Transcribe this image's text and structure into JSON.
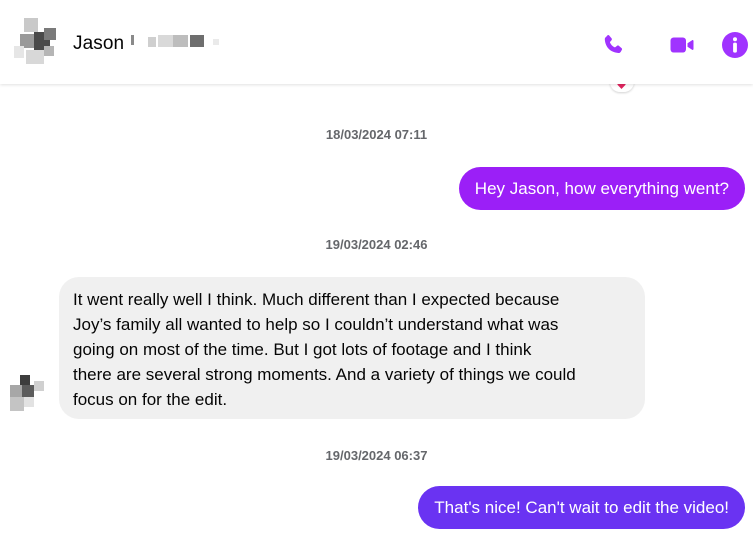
{
  "header": {
    "contact_name": "Jason",
    "avatar_icon": "contact-avatar-pixelated",
    "actions": [
      {
        "name": "voice-call",
        "icon": "phone-icon"
      },
      {
        "name": "video-call",
        "icon": "video-camera-icon"
      },
      {
        "name": "conversation-info",
        "icon": "info-icon"
      }
    ],
    "accent_color": "#a033ff"
  },
  "reaction": {
    "icon": "heart-icon",
    "color": "#e0245e"
  },
  "messages": [
    {
      "timestamp": "18/03/2024 07:11",
      "direction": "outgoing",
      "text": "Hey Jason, how everything went?",
      "bubble_color": "#9b1ff7"
    },
    {
      "timestamp": "19/03/2024 02:46",
      "direction": "incoming",
      "lines": [
        "It went really well I think. Much different than I expected because",
        "Joy’s family all wanted to help so I couldn’t understand what was",
        "going on most of the time. But I got lots of footage and I think",
        "there are several strong moments. And a variety of things we could",
        "focus on for the edit."
      ],
      "bubble_color": "#f0f0f0"
    },
    {
      "timestamp": "19/03/2024 06:37",
      "direction": "outgoing",
      "text": "That's nice! Can't wait to edit the video!",
      "bubble_color": "#6a33f2"
    }
  ]
}
